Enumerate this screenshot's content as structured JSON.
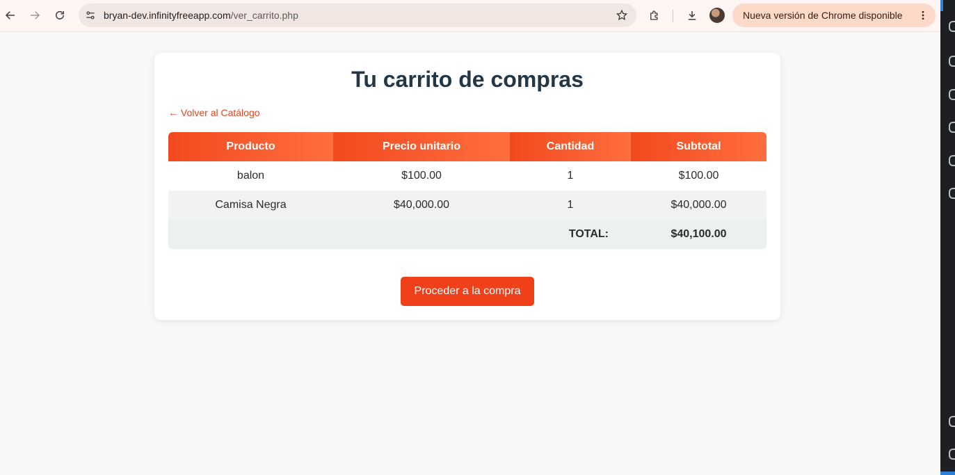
{
  "browser": {
    "url_host": "bryan-dev.infinityfreeapp.com",
    "url_path": "/ver_carrito.php",
    "update_label": "Nueva versión de Chrome disponible"
  },
  "page": {
    "title": "Tu carrito de compras",
    "back_link": "← Volver al Catálogo",
    "table": {
      "headers": [
        "Producto",
        "Precio unitario",
        "Cantidad",
        "Subtotal"
      ],
      "rows": [
        {
          "producto": "balon",
          "precio": "$100.00",
          "cantidad": "1",
          "subtotal": "$100.00"
        },
        {
          "producto": "Camisa Negra",
          "precio": "$40,000.00",
          "cantidad": "1",
          "subtotal": "$40,000.00"
        }
      ],
      "total_label": "TOTAL:",
      "total_value": "$40,100.00"
    },
    "buy_button": "Proceder a la compra"
  },
  "colors": {
    "accent": "#f0401a",
    "header_gradient_start": "#f24a1f",
    "header_gradient_end": "#ff6e3e",
    "title": "#243746"
  }
}
